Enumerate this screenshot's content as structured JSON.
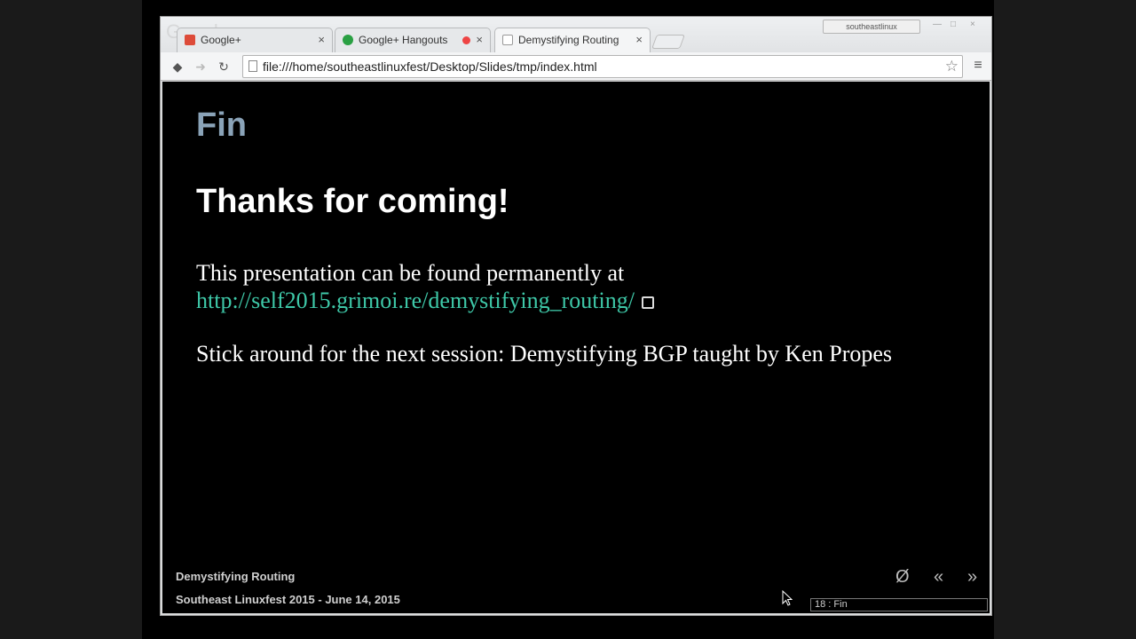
{
  "browser": {
    "tabs": [
      {
        "label": "Google+",
        "favicon_color": "#dd4b39"
      },
      {
        "label": "Google+ Hangouts",
        "favicon_color": "#2aa043"
      },
      {
        "label": "Demystifying Routing",
        "favicon_color": "#ffffff"
      }
    ],
    "tab_close_glyph": "×",
    "profile_badge": "southeastlinux",
    "address_bar": {
      "url": "file:///home/southeastlinuxfest/Desktop/Slides/tmp/index.html"
    }
  },
  "slide": {
    "heading": "Fin",
    "title": "Thanks for coming!",
    "paragraph1_text": "This presentation can be found permanently at",
    "paragraph1_link": "http://self2015.grimoi.re/demystifying_routing/",
    "paragraph2": "Stick around for the next session: Demystifying BGP taught by Ken Propes",
    "link_color": "#3ec8a8",
    "heading_color": "#8aa3b8"
  },
  "footer": {
    "presentation_title": "Demystifying Routing",
    "event": "Southeast Linuxfest 2015 - June 14, 2015",
    "controls": {
      "reset": "Ø",
      "prev": "«",
      "next": "»"
    },
    "slide_indicator": "18 : Fin"
  }
}
